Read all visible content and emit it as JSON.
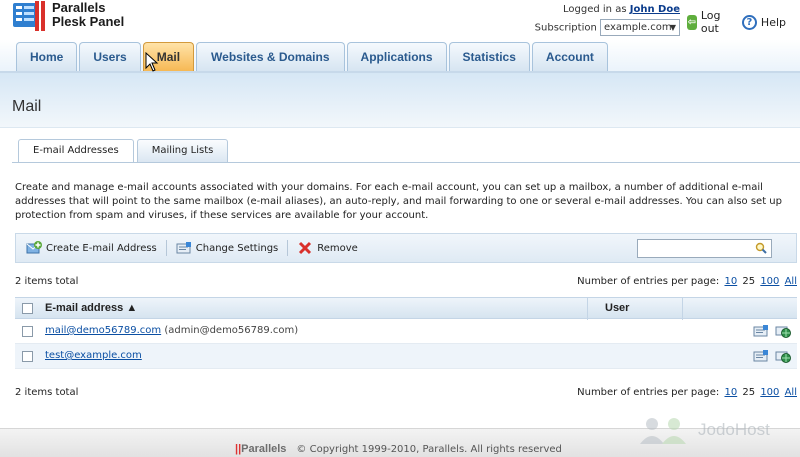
{
  "header": {
    "brand_line1": "Parallels",
    "brand_line2": "Plesk Panel",
    "logged_in_label": "Logged in as",
    "user_name": "John Doe",
    "subscription_label": "Subscription",
    "subscription_value": "example.com",
    "logout_label": "Log out",
    "help_label": "Help"
  },
  "nav": {
    "tabs": [
      {
        "label": "Home"
      },
      {
        "label": "Users"
      },
      {
        "label": "Mail"
      },
      {
        "label": "Websites & Domains"
      },
      {
        "label": "Applications"
      },
      {
        "label": "Statistics"
      },
      {
        "label": "Account"
      }
    ],
    "active": "Mail"
  },
  "page": {
    "title": "Mail",
    "subtabs": [
      {
        "label": "E-mail Addresses"
      },
      {
        "label": "Mailing Lists"
      }
    ],
    "description": "Create and manage e-mail accounts associated with your domains. For each e-mail account, you can set up a mailbox, a number of additional e-mail addresses that will point to the same mailbox (e-mail aliases), an auto-reply, and mail forwarding to one or several e-mail addresses. You can also set up protection from spam and viruses, if these services are available for your account."
  },
  "toolbar": {
    "create_label": "Create E-mail Address",
    "change_label": "Change Settings",
    "remove_label": "Remove",
    "search_value": ""
  },
  "list": {
    "total_text": "2 items total",
    "per_page_label": "Number of entries per page:",
    "per_page_options": [
      "10",
      "25",
      "100",
      "All"
    ],
    "selected_per_page": "25",
    "columns": {
      "email": "E-mail address ▲",
      "user": "User"
    },
    "rows": [
      {
        "email": "mail@demo56789.com",
        "note": "(admin@demo56789.com)"
      },
      {
        "email": "test@example.com",
        "note": ""
      }
    ]
  },
  "footer": {
    "logo": "Parallels",
    "copyright": "© Copyright 1999-2010, Parallels. All rights reserved",
    "watermark": "JodoHost"
  },
  "colors": {
    "active_tab": "#f6b751",
    "link": "#0b4fa3",
    "tab_text": "#2a5a8e"
  }
}
